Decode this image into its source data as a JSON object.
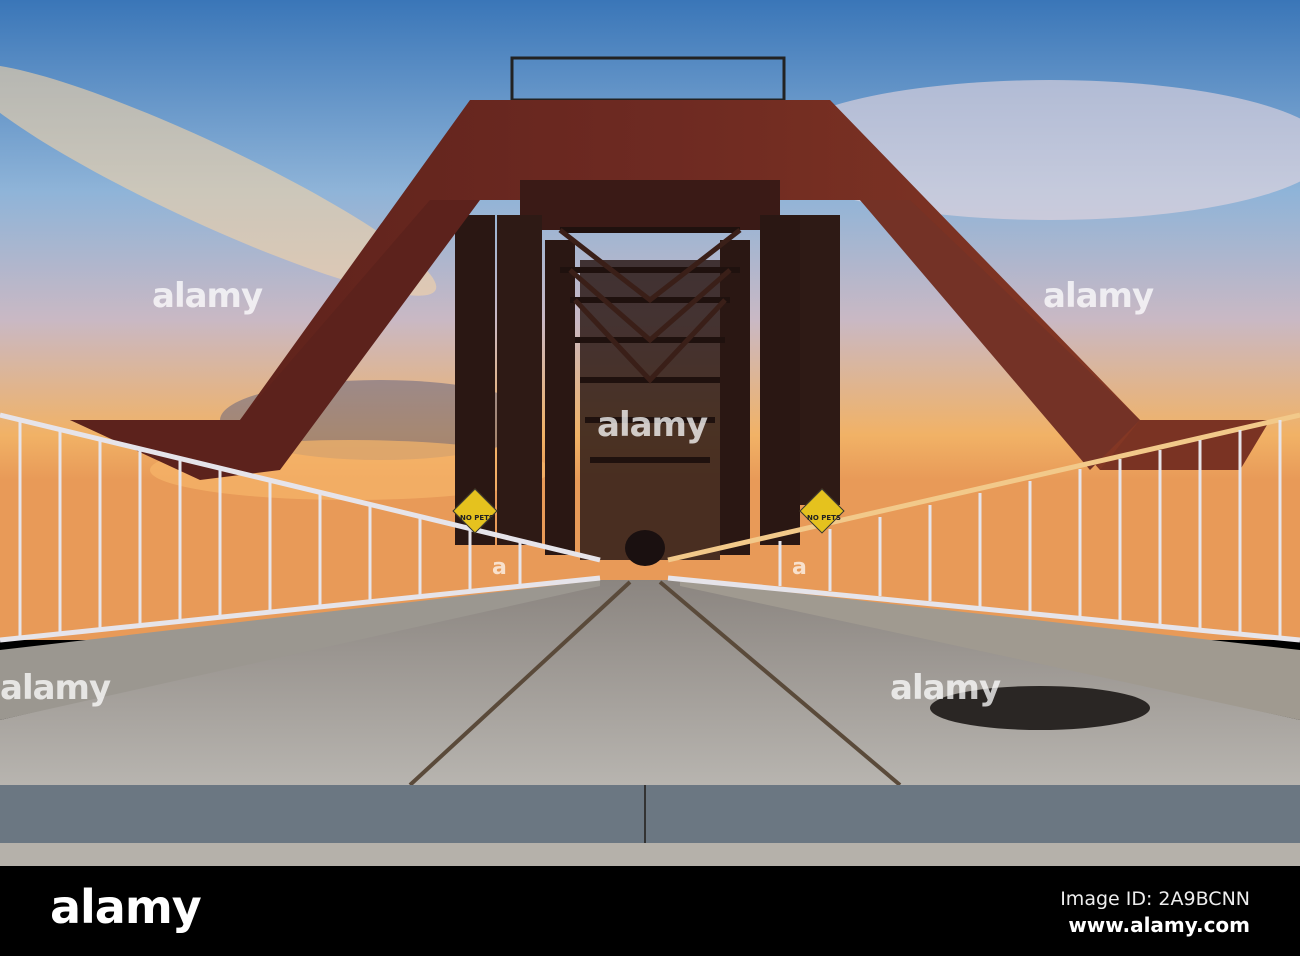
{
  "image": {
    "subject": "bridge",
    "signs": [
      "NO PETS",
      "NO PETS"
    ],
    "watermark": "alamy",
    "watermark_letter": "a"
  },
  "footer": {
    "logo": "alamy",
    "image_id": "Image ID: 2A9BCNN",
    "url": "www.alamy.com"
  },
  "colors": {
    "sky_top": "#3f7fc0",
    "sky_horizon": "#f2b060",
    "steel": "#6e2a22",
    "deck": "#b8b6b0",
    "railing": "#e8e8ea"
  }
}
